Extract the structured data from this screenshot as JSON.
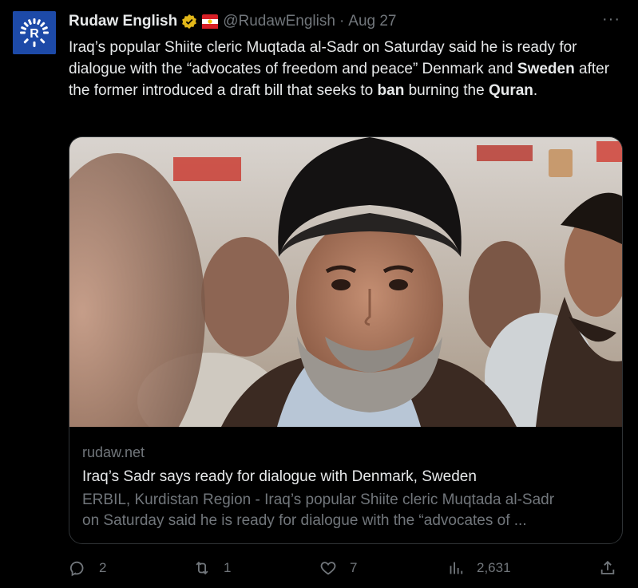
{
  "tweet": {
    "author_name": "Rudaw English",
    "handle": "@RudawEnglish",
    "separator": "·",
    "date": "Aug 27",
    "more_label": "···",
    "text_parts": [
      {
        "t": "Iraq’s popular Shiite cleric Muqtada al-Sadr on Saturday said he is ready for dialogue with the “advocates of freedom and peace” Denmark and ",
        "b": false
      },
      {
        "t": "Sweden",
        "b": true
      },
      {
        "t": " after the former introduced a draft bill that seeks to ",
        "b": false
      },
      {
        "t": "ban",
        "b": true
      },
      {
        "t": " burning the ",
        "b": false
      },
      {
        "t": "Quran",
        "b": true
      },
      {
        "t": ".",
        "b": false
      }
    ]
  },
  "card": {
    "domain": "rudaw.net",
    "title": "Iraq’s Sadr says ready for dialogue with Denmark, Sweden",
    "description_line1": "ERBIL, Kurdistan Region - Iraq’s popular Shiite cleric Muqtada al-Sadr",
    "description_line2": "on Saturday said he is ready for dialogue with the “advocates of ..."
  },
  "actions": {
    "replies": "2",
    "reposts": "1",
    "likes": "7",
    "views": "2,631"
  },
  "icons": {
    "avatar": "rudaw-logo-icon",
    "verified": "verified-badge-icon",
    "flag": "kurdistan-flag-icon",
    "reply": "reply-icon",
    "repost": "repost-icon",
    "like": "heart-icon",
    "views": "analytics-icon",
    "share": "share-icon"
  },
  "colors": {
    "background": "#000000",
    "text": "#e7e9ea",
    "muted": "#71767b",
    "border": "#2f3336",
    "verified_gold": "#e2b719",
    "avatar_blue": "#1d4aa8"
  }
}
